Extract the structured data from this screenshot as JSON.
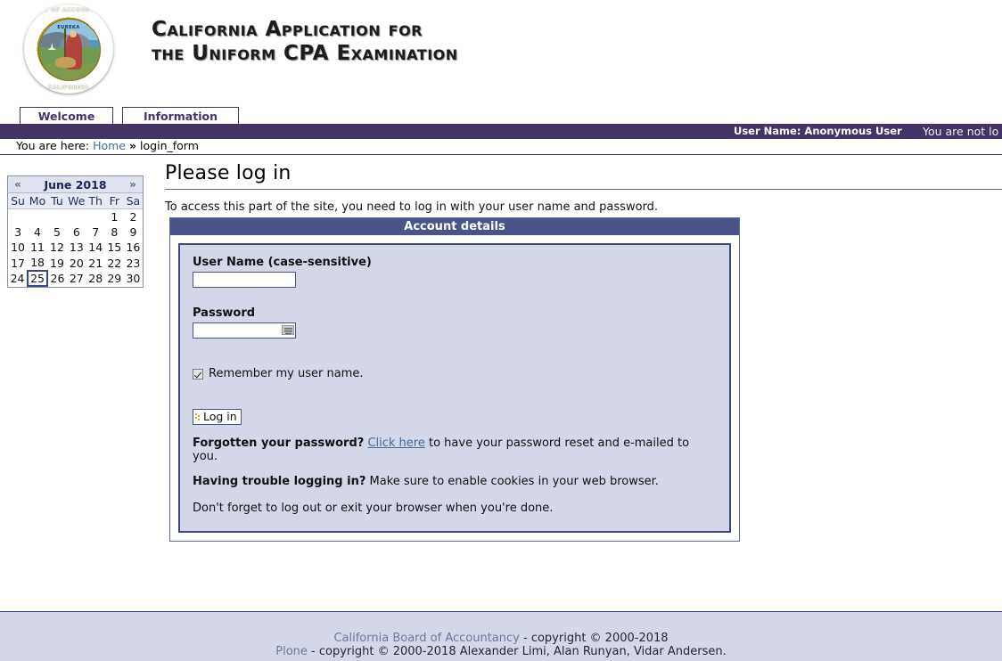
{
  "header": {
    "logo_alt": "California Board of Accountancy seal",
    "seal_text_top": "BOARD OF ACCOUNTANCY",
    "seal_text_bottom": "CALIFORNIA",
    "seal_motto": "EUREKA",
    "title_line1": "California Application for",
    "title_line2": "the Uniform CPA Examination"
  },
  "tabs": [
    {
      "label": "Welcome"
    },
    {
      "label": "Information"
    }
  ],
  "personal_bar": {
    "user_label": "User Name: Anonymous User",
    "status": "You are not lo"
  },
  "breadcrumb": {
    "prefix": "You are here:",
    "home": "Home",
    "separator": "»",
    "current": "login_form"
  },
  "calendar": {
    "prev_label": "«",
    "next_label": "»",
    "title": "June 2018",
    "weekdays": [
      "Su",
      "Mo",
      "Tu",
      "We",
      "Th",
      "Fr",
      "Sa"
    ],
    "weeks": [
      [
        "",
        "",
        "",
        "",
        "",
        "1",
        "2"
      ],
      [
        "3",
        "4",
        "5",
        "6",
        "7",
        "8",
        "9"
      ],
      [
        "10",
        "11",
        "12",
        "13",
        "14",
        "15",
        "16"
      ],
      [
        "17",
        "18",
        "19",
        "20",
        "21",
        "22",
        "23"
      ],
      [
        "24",
        "25",
        "26",
        "27",
        "28",
        "29",
        "30"
      ]
    ],
    "today": "25"
  },
  "main": {
    "page_title": "Please log in",
    "description": "To access this part of the site, you need to log in with your user name and password."
  },
  "login_form": {
    "legend": "Account details",
    "username_label": "User Name (case-sensitive)",
    "username_value": "",
    "username_placeholder": "",
    "password_label": "Password",
    "password_value": "",
    "password_placeholder": "",
    "password_icon": "keyboard-icon",
    "remember_label": "Remember my user name.",
    "remember_checked": true,
    "submit_label": "Log in",
    "forgot_bold": "Forgotten your password?",
    "forgot_link": "Click here",
    "forgot_rest": "to have your password reset and e-mailed to you.",
    "trouble_bold": "Having trouble logging in?",
    "trouble_rest": "Make sure to enable cookies in your web browser.",
    "logout_note": "Don't forget to log out or exit your browser when you're done."
  },
  "footer": {
    "line1_link": "California Board of Accountancy",
    "line1_rest": "- copyright © 2000-2018",
    "line2_link": "Plone",
    "line2_rest": "- copyright © 2000-2018 Alexander Limi, Alan Runyan, Vidar Andersen."
  },
  "colors": {
    "navy": "#443366",
    "panel_blue": "#4a5489",
    "panel_fill": "#d3d7e8",
    "link": "#436b96",
    "accent_orange": "#f0a000"
  }
}
